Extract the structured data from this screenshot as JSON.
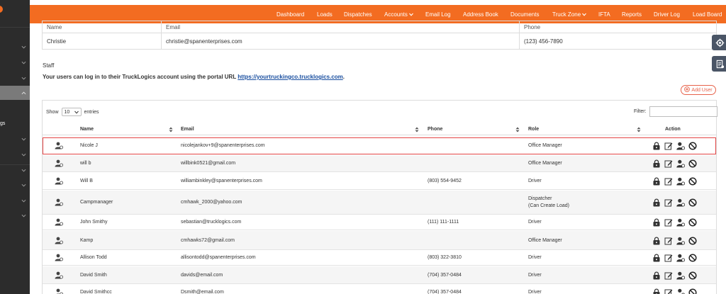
{
  "sidebar": {
    "fragment_text": "gs"
  },
  "nav": {
    "items": [
      {
        "label": "Dashboard",
        "dropdown": false
      },
      {
        "label": "Loads",
        "dropdown": false
      },
      {
        "label": "Dispatches",
        "dropdown": false
      },
      {
        "label": "Accounts",
        "dropdown": true
      },
      {
        "label": "Email Log",
        "dropdown": false
      },
      {
        "label": "Address Book",
        "dropdown": false
      },
      {
        "label": "Documents",
        "dropdown": false
      },
      {
        "label": "Truck Zone",
        "dropdown": true
      },
      {
        "label": "IFTA",
        "dropdown": false
      },
      {
        "label": "Reports",
        "dropdown": false
      },
      {
        "label": "Driver Log",
        "dropdown": false
      },
      {
        "label": "Load Board",
        "dropdown": false
      }
    ]
  },
  "contact": {
    "headers": [
      "Name",
      "Email",
      "Phone"
    ],
    "row": [
      "Christie",
      "christie@spanenterprises.com",
      "(123) 456-7890"
    ]
  },
  "staff": {
    "section_label": "Staff",
    "note_prefix": "Your users can log in to their TruckLogics account using the portal URL ",
    "portal_url": "https://yourtruckingco.trucklogics.com",
    "note_suffix": ".",
    "add_user_label": "Add User",
    "show_label": "Show",
    "entries_value": "10",
    "entries_label": "entries",
    "filter_label": "Filter:",
    "filter_value": "",
    "columns": {
      "name": "Name",
      "email": "Email",
      "phone": "Phone",
      "role": "Role",
      "action": "Action"
    },
    "rows": [
      {
        "name": "Nicole J",
        "email": "nicolejankov+9@spanenterprises.com",
        "phone": "",
        "role": "Office Manager",
        "role2": ""
      },
      {
        "name": "will b",
        "email": "willbink0521@gmail.com",
        "phone": "",
        "role": "Office Manager",
        "role2": ""
      },
      {
        "name": "Will B",
        "email": "williambinkley@spanenterprises.com",
        "phone": "(803) 554-9452",
        "role": "Driver",
        "role2": ""
      },
      {
        "name": "Campmanager",
        "email": "cmhawk_2000@yahoo.com",
        "phone": "",
        "role": "Dispatcher",
        "role2": "(Can Create Load)"
      },
      {
        "name": "John Smithy",
        "email": "sebastian@trucklogics.com",
        "phone": "(111) 111-1111",
        "role": "Driver",
        "role2": ""
      },
      {
        "name": "Kamp",
        "email": "cmhawks72@gmail.com",
        "phone": "",
        "role": "Office Manager",
        "role2": ""
      },
      {
        "name": "Allison Todd",
        "email": "allisontodd@spanenterprises.com",
        "phone": "(803) 322-3810",
        "role": "Driver",
        "role2": ""
      },
      {
        "name": "David Smith",
        "email": "davids@email.com",
        "phone": "(704) 357-0484",
        "role": "Driver",
        "role2": ""
      },
      {
        "name": "David Smithcc",
        "email": "Dsmith@email.com",
        "phone": "(704) 357-0484",
        "role": "Driver",
        "role2": ""
      }
    ]
  },
  "colors": {
    "brand": "#f36c21",
    "sidebar": "#2c2c2c",
    "highlight": "#e34545"
  }
}
